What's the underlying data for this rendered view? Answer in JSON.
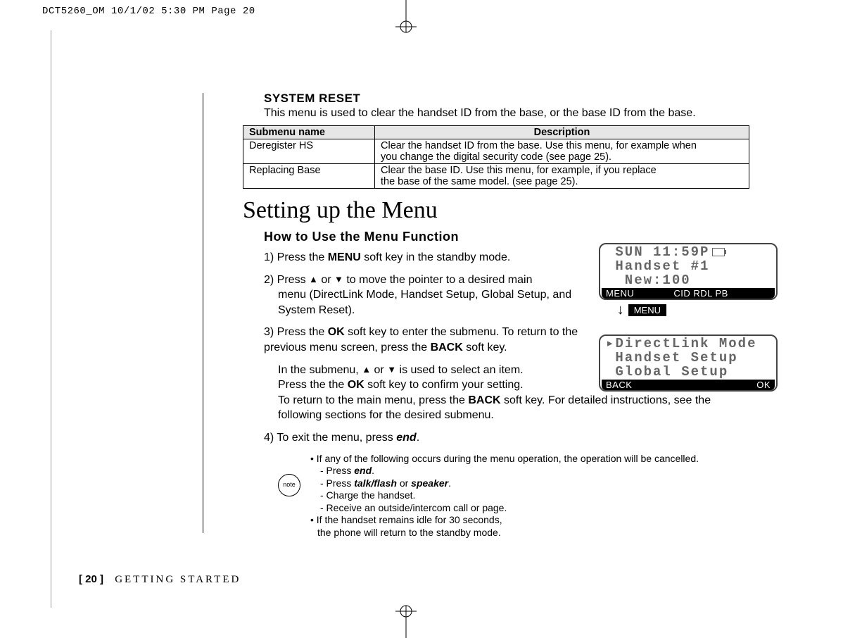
{
  "printer_header": "DCT5260_OM  10/1/02  5:30 PM  Page 20",
  "system_reset": {
    "title": "SYSTEM RESET",
    "intro": "This menu is used to clear the handset ID from the base, or the base ID from the base.",
    "table": {
      "col1": "Submenu name",
      "col2": "Description",
      "rows": [
        {
          "name": "Deregister HS",
          "desc_l1": "Clear the handset ID from the base. Use this menu, for example when",
          "desc_l2": "you change the digital security code (see page 25)."
        },
        {
          "name": "Replacing Base",
          "desc_l1": "Clear the base ID. Use this menu, for example, if you replace",
          "desc_l2": "the base of the same model. (see page 25)."
        }
      ]
    }
  },
  "heading": "Setting up the Menu",
  "subheading": "How to Use the Menu Function",
  "steps": {
    "s1_pre": "1) Press the ",
    "s1_bold": "MENU",
    "s1_post": " soft key in the standby mode.",
    "s2_pre": "2) Press ",
    "s2_mid": " or ",
    "s2_post": " to move the pointer to a desired main",
    "s2_body": "menu (DirectLink Mode, Handset Setup, Global Setup, and System Reset).",
    "s3_pre": "3) Press the ",
    "s3_bold1": "OK",
    "s3_mid1": " soft key to enter the submenu. To return to the previous menu screen, press the ",
    "s3_bold2": "BACK",
    "s3_post1": " soft key.",
    "s3_line2_pre": "In the submenu, ",
    "s3_line2_mid": " or ",
    "s3_line2_post": " is used to select an item.",
    "s3_line3_pre": "Press the the ",
    "s3_line3_bold": "OK",
    "s3_line3_post": " soft key to confirm your setting.",
    "s3_line4_pre": "To return to the main menu, press the ",
    "s3_line4_bold": "BACK",
    "s3_line4_post": " soft key. For detailed instructions, see the following sections for the desired submenu.",
    "s4_pre": "4) To exit the menu, press ",
    "s4_bold": "end",
    "s4_post": "."
  },
  "note": {
    "label": "note",
    "b1": "• If any of the following occurs during the menu operation, the operation will be cancelled.",
    "d1_pre": "- Press ",
    "d1_bold": "end",
    "d1_post": ".",
    "d2_pre": "- Press ",
    "d2_bold1": "talk/flash",
    "d2_mid": " or ",
    "d2_bold2": "speaker",
    "d2_post": ".",
    "d3": "- Charge the handset.",
    "d4": "- Receive an outside/intercom call or page.",
    "b2_l1": "• If the handset remains idle for 30 seconds,",
    "b2_l2": "the phone will return to the standby mode."
  },
  "lcd1": {
    "l1": " SUN 11:59P",
    "l2": " Handset #1",
    "l3": "  New:100",
    "bar_left": "MENU",
    "bar_mid": "CID RDL PB",
    "bar_right": " "
  },
  "menu_tag": "MENU",
  "lcd2": {
    "l1": "DirectLink Mode",
    "l2": "Handset Setup",
    "l3": "Global Setup",
    "bar_left": "BACK",
    "bar_right": "OK"
  },
  "footer": {
    "pagenum": "[ 20 ]",
    "section": "GETTING STARTED"
  },
  "glyphs": {
    "up": "▲",
    "down": "▼",
    "pointer": "▸"
  }
}
